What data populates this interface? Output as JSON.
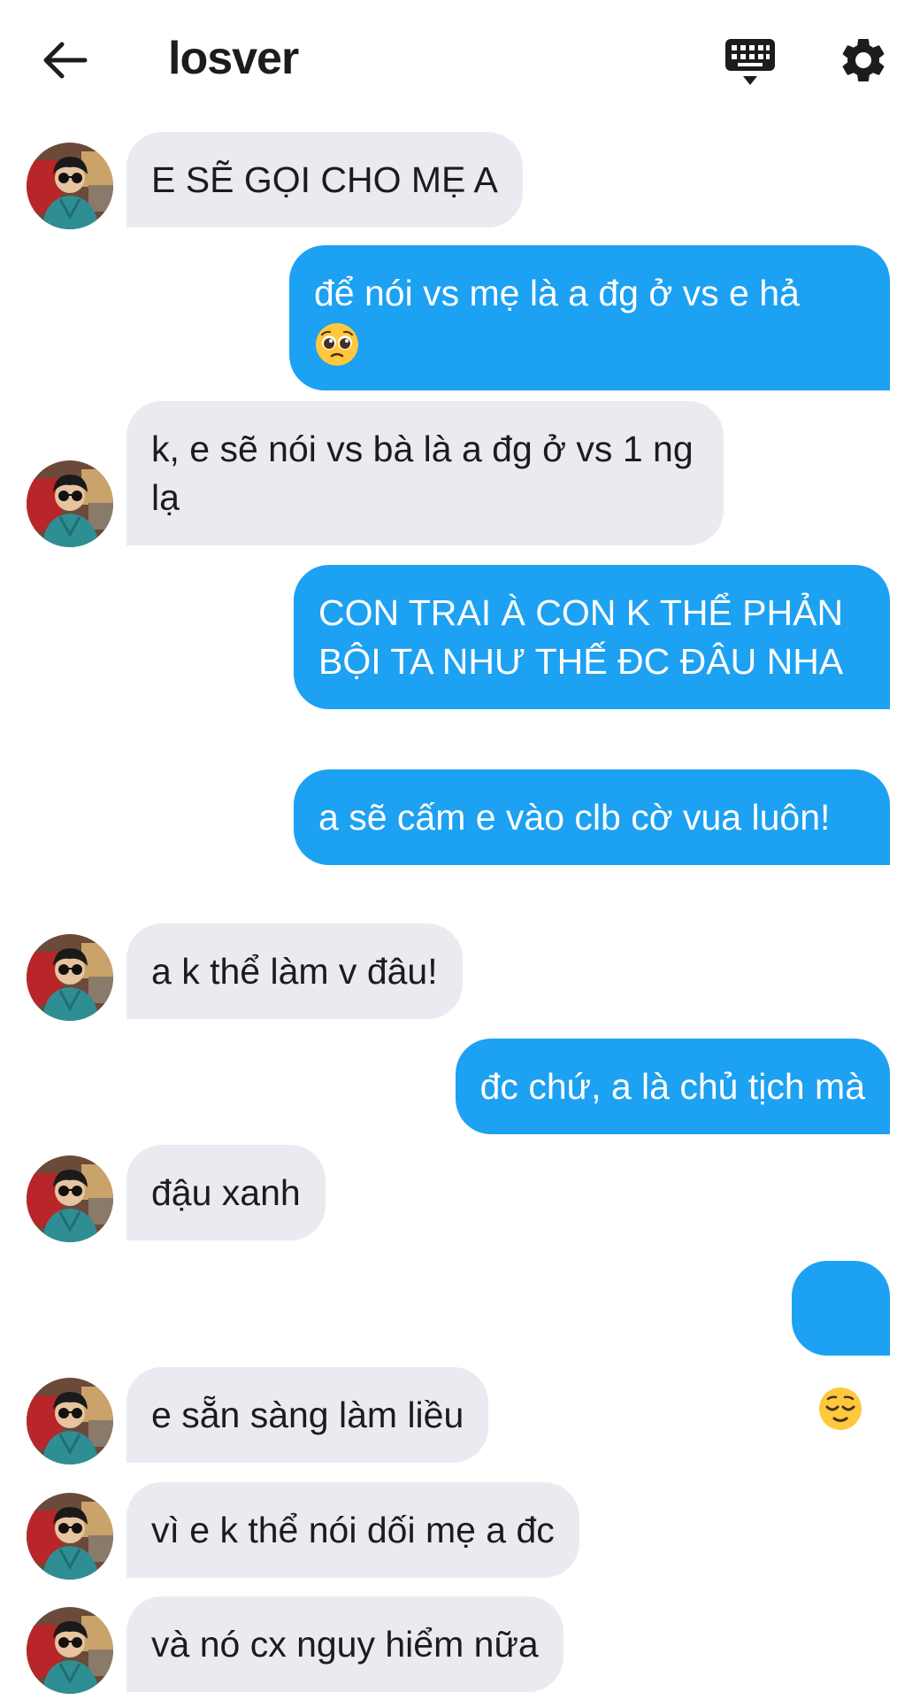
{
  "header": {
    "title": "losver"
  },
  "icons": {
    "back": "arrow-left-icon",
    "keyboard": "keyboard-icon",
    "settings": "gear-icon"
  },
  "colors": {
    "outgoing_bubble": "#1da1f2",
    "incoming_bubble": "#e9ebf0",
    "text": "#1c1c1c"
  },
  "messages": [
    {
      "direction": "incoming",
      "text": "E SẼ GỌI CHO MẸ A"
    },
    {
      "direction": "outgoing",
      "text": "để nói vs mẹ là a đg ở vs e hả",
      "emoji": "pleading-face-emoji"
    },
    {
      "direction": "incoming",
      "text": "k, e sẽ nói vs bà là a đg ở vs 1 ng lạ"
    },
    {
      "direction": "outgoing",
      "text": "CON TRAI À CON K THỂ PHẢN BỘI TA NHƯ THẾ ĐC ĐÂU NHA"
    },
    {
      "direction": "outgoing",
      "text": "a sẽ cấm e vào clb cờ vua luôn!"
    },
    {
      "direction": "incoming",
      "text": "a k thể làm v đâu!"
    },
    {
      "direction": "outgoing",
      "text": "đc chứ, a là chủ tịch mà"
    },
    {
      "direction": "incoming",
      "text": "đậu xanh"
    },
    {
      "direction": "outgoing",
      "text": "",
      "emoji": "relieved-face-emoji"
    },
    {
      "direction": "incoming",
      "text": "e sẵn sàng làm liều"
    },
    {
      "direction": "incoming",
      "text": "vì e k thể nói dối mẹ a đc"
    },
    {
      "direction": "incoming",
      "text": "và nó cx nguy hiểm nữa"
    }
  ]
}
